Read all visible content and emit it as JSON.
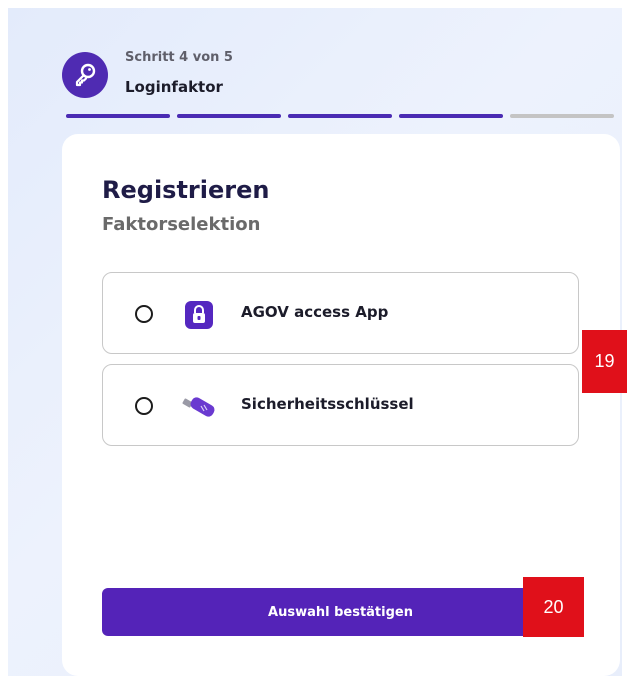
{
  "stepper": {
    "step_text": "Schritt 4 von 5",
    "step_title": "Loginfaktor",
    "icon": "key-icon",
    "progress": {
      "current": 4,
      "total": 5
    }
  },
  "colors": {
    "accent": "#5423b8",
    "progress_done": "#4a2bb3",
    "progress_todo": "#c4c4c4",
    "marker": "#e0101a"
  },
  "card": {
    "heading": "Registrieren",
    "subheading": "Faktorselektion",
    "options": [
      {
        "label": "AGOV access App",
        "icon": "lock-app-icon",
        "selected": false
      },
      {
        "label": "Sicherheitsschlüssel",
        "icon": "usb-key-icon",
        "selected": false
      }
    ],
    "confirm_label": "Auswahl bestätigen"
  },
  "markers": [
    "19",
    "20"
  ]
}
